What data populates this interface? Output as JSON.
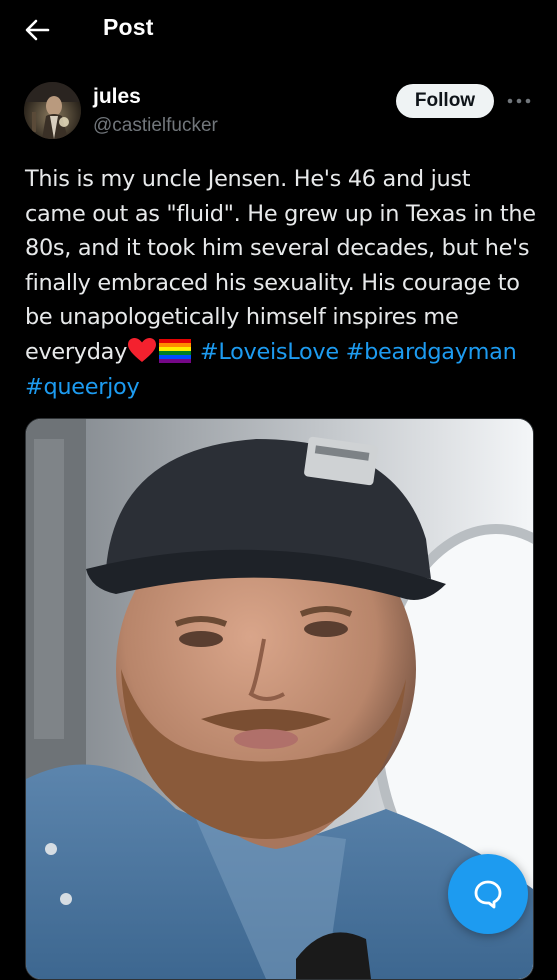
{
  "header": {
    "title": "Post",
    "back_icon": "arrow-left-icon"
  },
  "author": {
    "display_name": "jules",
    "handle": "@castielfucker",
    "avatar": "profile-photo"
  },
  "follow_label": "Follow",
  "more_icon": "ellipsis-icon",
  "tweet": {
    "line_text_1": "This is my uncle Jensen. He's 46 and just came out as \"fluid\". He grew up in Texas in the 80s, and it took him several decades, but he's finally embraced his sexuality. His courage to be unapologetically himself inspires me everyday",
    "emojis": [
      "red-heart-icon",
      "rainbow-flag-icon"
    ],
    "hashtags": [
      "#LoveisLove",
      "#beardgayman",
      "#queerjoy"
    ]
  },
  "media": {
    "description_icon": "photo-of-man-in-cap"
  },
  "colors": {
    "background": "#000000",
    "text": "#e7e9ea",
    "secondary_text": "#71767b",
    "accent": "#1d9bf0",
    "follow_bg": "#eff3f4"
  },
  "fab_icon": "reply-bubble-icon"
}
